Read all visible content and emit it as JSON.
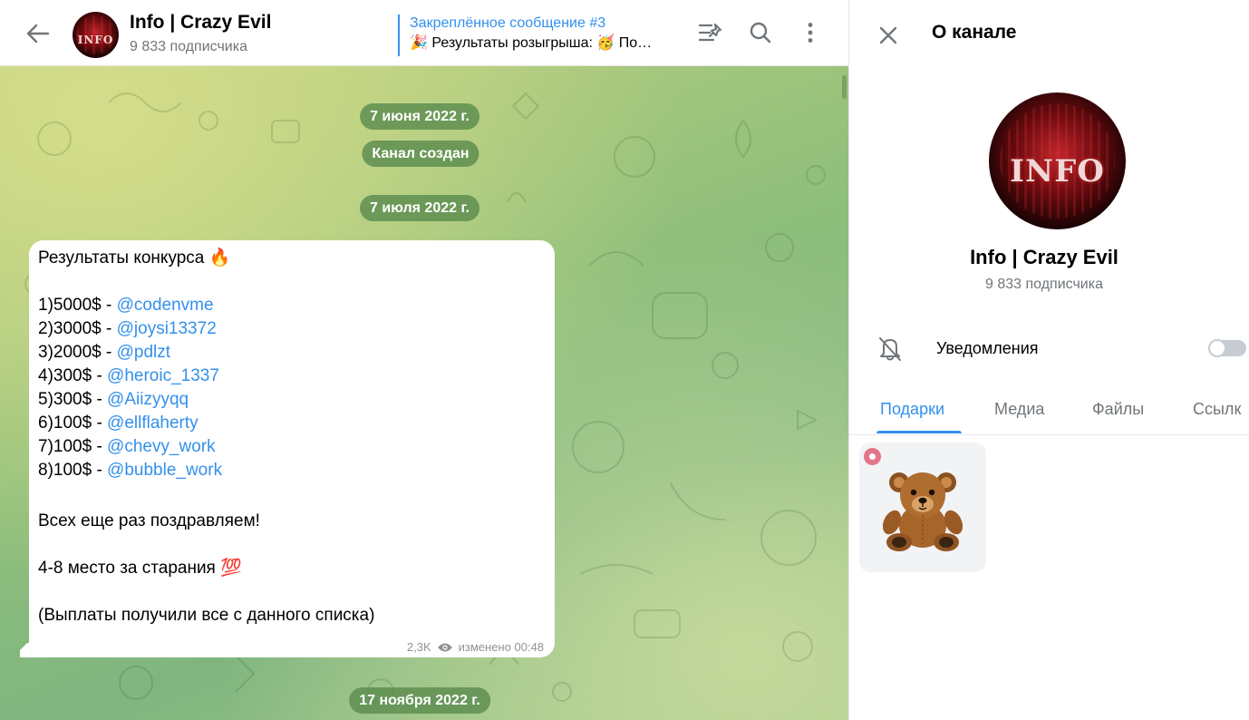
{
  "header": {
    "channel_title": "Info | Crazy Evil",
    "subscribers": "9 833 подписчика",
    "avatar_text": "INFO",
    "pinned_title": "Закреплённое сообщение #3",
    "pinned_text": "🎉 Результаты розыгрыша: 🥳 По…",
    "icons": [
      "back-arrow-icon",
      "pinned-list-icon",
      "search-icon",
      "more-vertical-icon"
    ]
  },
  "chat": {
    "dates": [
      "7 июня 2022 г.",
      "Канал создан",
      "7 июля 2022 г.",
      "17 ноября 2022 г."
    ],
    "message": {
      "title": "Результаты конкурса 🔥",
      "lines": [
        {
          "prefix": "1)5000$ - ",
          "mention": "@codenvme"
        },
        {
          "prefix": "2)3000$ - ",
          "mention": "@joysi13372"
        },
        {
          "prefix": "3)2000$ - ",
          "mention": "@pdlzt"
        },
        {
          "prefix": "4)300$ - ",
          "mention": "@heroic_1337"
        },
        {
          "prefix": "5)300$ - ",
          "mention": "@Aiizyyqq"
        },
        {
          "prefix": "6)100$ - ",
          "mention": "@ellflaherty"
        },
        {
          "prefix": "7)100$ - ",
          "mention": "@chevy_work"
        },
        {
          "prefix": "8)100$ - ",
          "mention": "@bubble_work"
        }
      ],
      "congrats": "Всех еще раз поздравляем!",
      "places": "4-8 место за старания 💯",
      "payout": "(Выплаты получили все с данного списка)",
      "views": "2,3K",
      "edited": "изменено 00:48"
    }
  },
  "panel": {
    "title": "О канале",
    "name": "Info | Crazy Evil",
    "subscribers": "9 833 подписчика",
    "avatar_text": "INFO",
    "notifications_label": "Уведомления",
    "notifications_on": false,
    "tabs": [
      "Подарки",
      "Медиа",
      "Файлы",
      "Ссылк"
    ],
    "active_tab": "Подарки",
    "gift": "🧸",
    "colors": {
      "accent": "#3390ec",
      "badge": "#e2758b"
    }
  }
}
